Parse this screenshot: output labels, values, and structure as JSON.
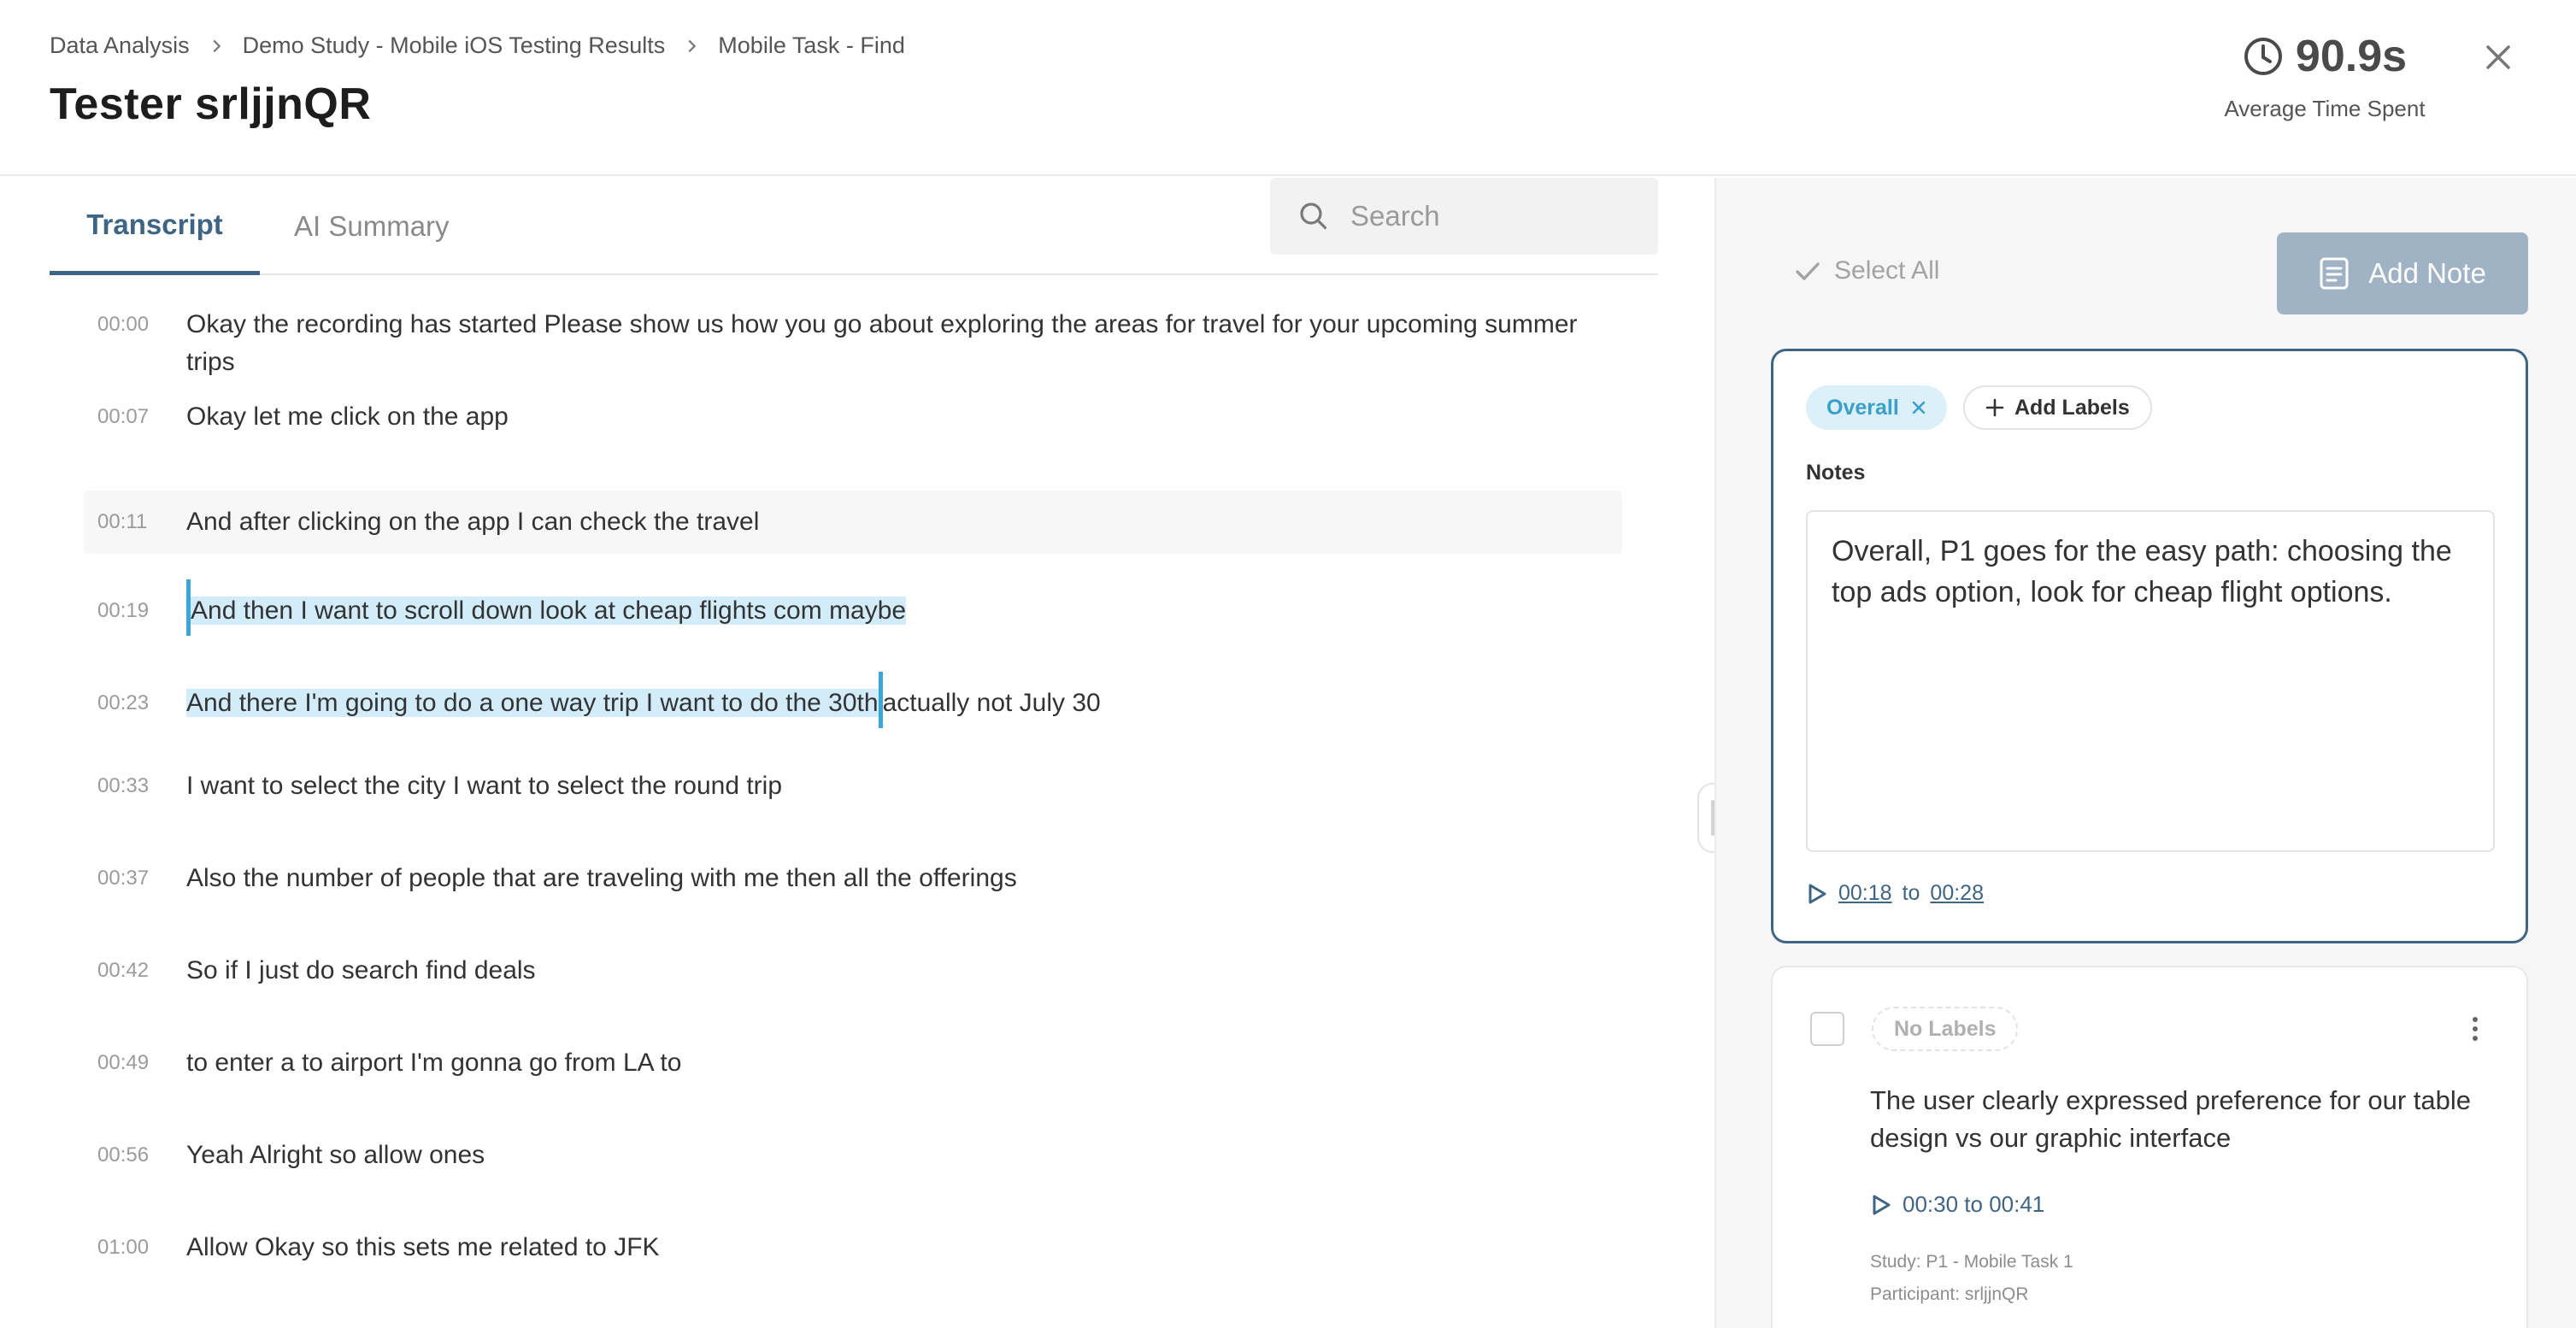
{
  "breadcrumb": [
    "Data Analysis",
    "Demo Study - Mobile iOS Testing Results",
    "Mobile Task - Find"
  ],
  "title": "Tester srljjnQR",
  "metric": {
    "value": "90.9s",
    "label": "Average Time Spent"
  },
  "tabs": {
    "transcript": "Transcript",
    "summary": "AI Summary"
  },
  "search": {
    "placeholder": "Search"
  },
  "transcript": [
    {
      "time": "00:00",
      "text": "Okay the recording has started Please show us how you go about exploring the areas for travel for your upcoming summer trips"
    },
    {
      "time": "00:07",
      "text": "Okay let me click on the app"
    },
    {
      "time": "00:11",
      "text": "And after clicking on the app I can check the travel"
    },
    {
      "time": "00:19",
      "text": "And then I want to scroll down look at cheap flights com maybe"
    },
    {
      "time": "00:23",
      "text_highlight": "And there I'm going to do a one way trip I want to do the 30th",
      "text_rest": "actually not July 30"
    },
    {
      "time": "00:33",
      "text": "I want to select the city I want to select the round trip"
    },
    {
      "time": "00:37",
      "text": "Also the number of people that are traveling with me then all the offerings"
    },
    {
      "time": "00:42",
      "text": "So if I just do search find deals"
    },
    {
      "time": "00:49",
      "text": "to enter a to airport I'm gonna go from LA to"
    },
    {
      "time": "00:56",
      "text": "Yeah Alright so allow ones"
    },
    {
      "time": "01:00",
      "text": "Allow Okay so this sets me related to JFK"
    }
  ],
  "panel": {
    "select_all": "Select All",
    "add_note": "Add Note",
    "editor": {
      "label_chip": "Overall",
      "add_labels": "Add Labels",
      "notes_label": "Notes",
      "notes_value": "Overall, P1 goes for the easy path: choosing the top ads option, look for cheap flight options.",
      "start": "00:18",
      "to": "to",
      "end": "00:28"
    },
    "note": {
      "labels": "No Labels",
      "text": "The user clearly expressed preference for our table design vs our graphic interface",
      "range": "00:30 to 00:41",
      "study": "Study: P1 - Mobile Task 1",
      "participant": "Participant: srljjnQR"
    }
  },
  "colors": {
    "accent": "#3e6586",
    "highlight": "#d3ecf9",
    "chip": "#dcf0f9",
    "button_disabled": "#9fb3c5"
  }
}
